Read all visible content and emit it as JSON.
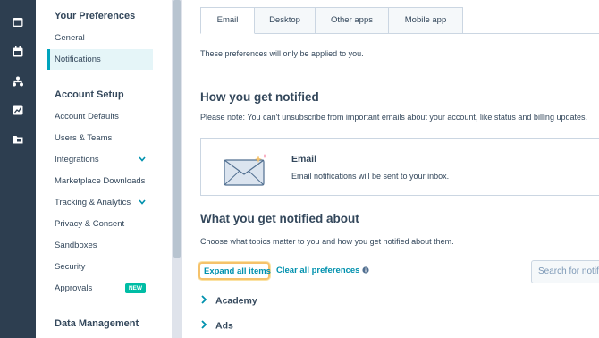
{
  "rail": {
    "icons": [
      "browser-icon",
      "calendar-icon",
      "org-chart-icon",
      "reports-icon",
      "folder-icon"
    ]
  },
  "sidebar": {
    "sections": [
      {
        "title": "Your Preferences",
        "items": [
          {
            "label": "General"
          },
          {
            "label": "Notifications",
            "active": true
          }
        ]
      },
      {
        "title": "Account Setup",
        "items": [
          {
            "label": "Account Defaults"
          },
          {
            "label": "Users & Teams"
          },
          {
            "label": "Integrations",
            "expandable": true
          },
          {
            "label": "Marketplace Downloads"
          },
          {
            "label": "Tracking & Analytics",
            "expandable": true
          },
          {
            "label": "Privacy & Consent"
          },
          {
            "label": "Sandboxes"
          },
          {
            "label": "Security"
          },
          {
            "label": "Approvals",
            "badge": "NEW"
          }
        ]
      },
      {
        "title": "Data Management",
        "items": []
      }
    ]
  },
  "tabs": [
    "Email",
    "Desktop",
    "Other apps",
    "Mobile app"
  ],
  "active_tab": "Email",
  "main": {
    "tab_note": "These preferences will only be applied to you.",
    "how_heading": "How you get notified",
    "how_note": "Please note: You can't unsubscribe from important emails about your account, like status and billing updates.",
    "channel_card": {
      "title": "Email",
      "description": "Email notifications will be sent to your inbox."
    },
    "what_heading": "What you get notified about",
    "what_note": "Choose what topics matter to you and how you get notified about them.",
    "expand_all_label": "Expand all items",
    "clear_all_label": "Clear all preferences",
    "search_placeholder": "Search for notifications",
    "topics": [
      "Academy",
      "Ads"
    ]
  },
  "colors": {
    "rail": "#2d3e50",
    "accent": "#00a4bd",
    "link": "#0091ae",
    "badge": "#00bda5",
    "highlight": "#f5c26b"
  }
}
